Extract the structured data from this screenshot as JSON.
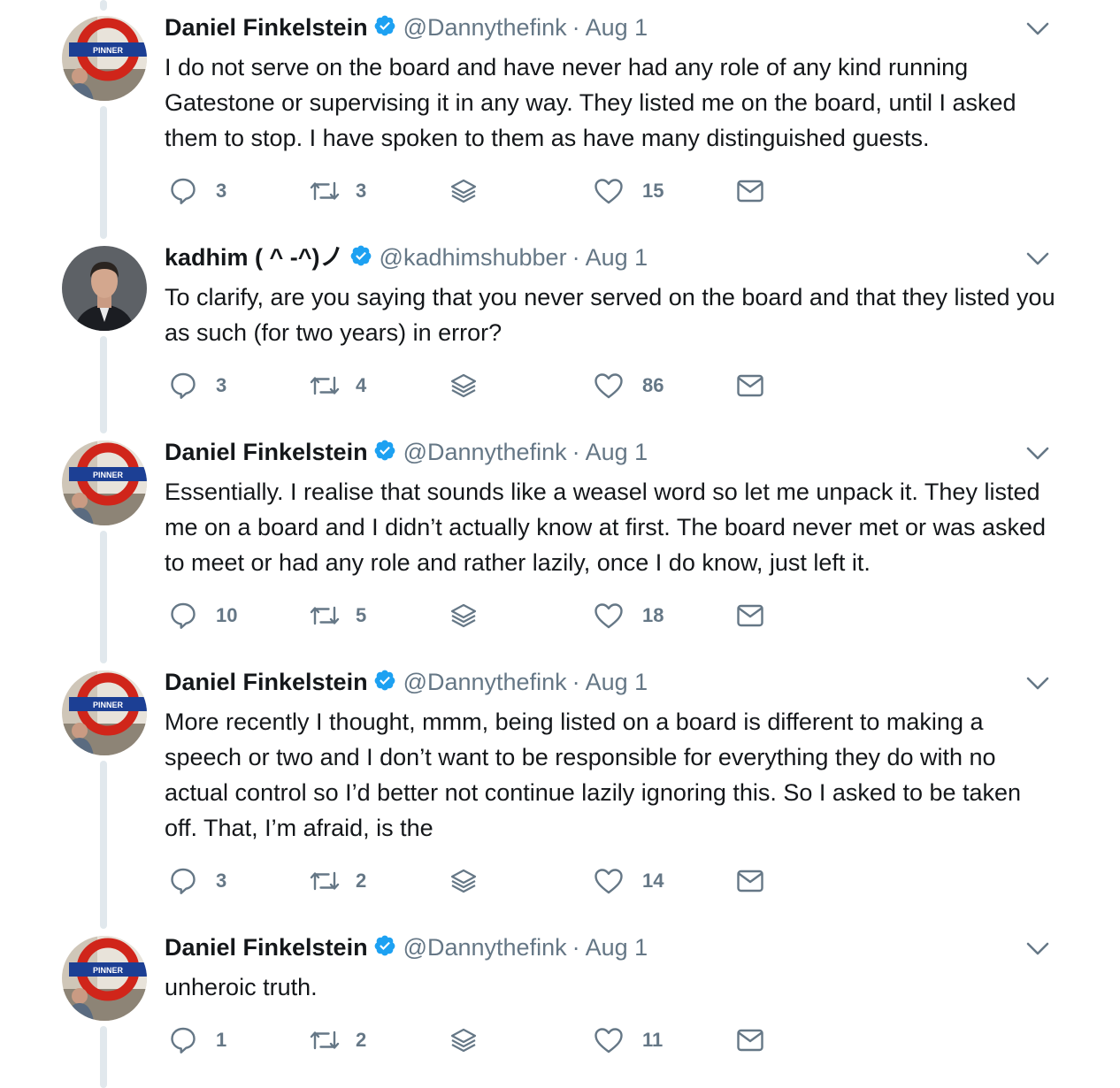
{
  "tweets": [
    {
      "name": "Daniel Finkelstein",
      "handle": "@Dannythefink",
      "sep": "·",
      "date": "Aug 1",
      "avatar": "pinner-roundel-avatar",
      "text": "I do not serve on the board and have never had any role of any kind running Gatestone or supervising it in any way. They listed me on the board, until I asked them to stop. I have spoken to them as have many distinguished guests.",
      "replies": "3",
      "retweets": "3",
      "likes": "15"
    },
    {
      "name": "kadhim ( ^ -^)ノ",
      "handle": "@kadhimshubber",
      "sep": "·",
      "date": "Aug 1",
      "avatar": "portrait-avatar",
      "text": "To clarify, are you saying that you never served on the board and that they listed you as such (for two years) in error?",
      "replies": "3",
      "retweets": "4",
      "likes": "86"
    },
    {
      "name": "Daniel Finkelstein",
      "handle": "@Dannythefink",
      "sep": "·",
      "date": "Aug 1",
      "avatar": "pinner-roundel-avatar",
      "text": "Essentially. I realise that sounds like a weasel word so let me unpack it. They listed me on a board and I didn’t actually know at first. The board never met or was asked to meet or had any role and rather lazily, once I do know, just left it.",
      "replies": "10",
      "retweets": "5",
      "likes": "18"
    },
    {
      "name": "Daniel Finkelstein",
      "handle": "@Dannythefink",
      "sep": "·",
      "date": "Aug 1",
      "avatar": "pinner-roundel-avatar",
      "text": "More recently I thought, mmm, being listed on a board is different to making a speech or two and I don’t want to be responsible for everything they do with no actual control so I’d better not continue lazily ignoring this. So I asked to be taken off. That, I’m afraid, is the",
      "replies": "3",
      "retweets": "2",
      "likes": "14"
    },
    {
      "name": "Daniel Finkelstein",
      "handle": "@Dannythefink",
      "sep": "·",
      "date": "Aug 1",
      "avatar": "pinner-roundel-avatar",
      "text": "unheroic truth.",
      "replies": "1",
      "retweets": "2",
      "likes": "11"
    }
  ],
  "roundel_label": "PINNER",
  "colors": {
    "text": "#14171a",
    "secondary": "#657786",
    "verified": "#1da1f2",
    "thread_line": "#e1e8ed",
    "roundel_red": "#d0251a",
    "roundel_blue": "#1c3f94"
  },
  "icons": [
    "reply-icon",
    "retweet-icon",
    "stack-icon",
    "like-icon",
    "message-icon",
    "verified-icon",
    "chevron-down-icon"
  ]
}
